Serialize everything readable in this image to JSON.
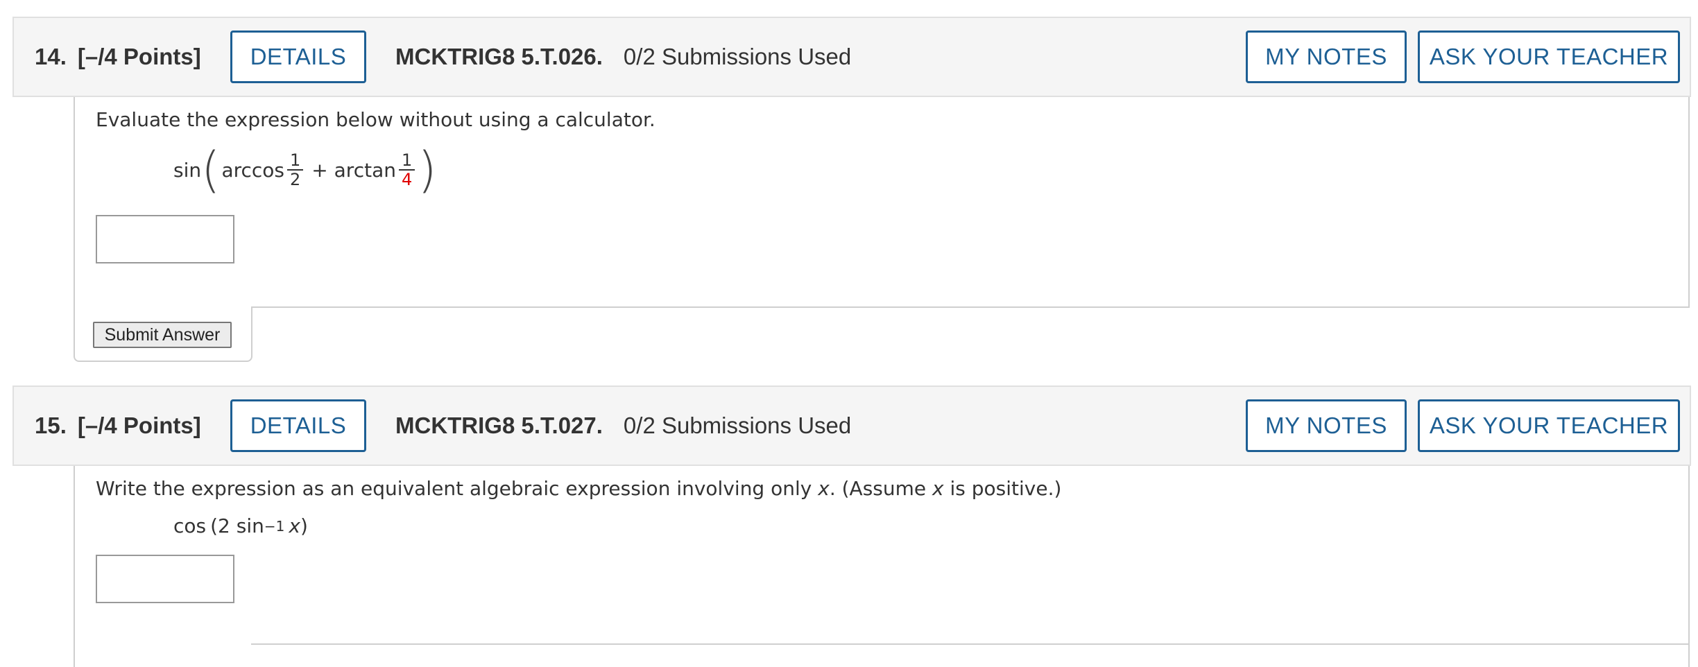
{
  "questions": [
    {
      "number": "14.",
      "points": "[–/4 Points]",
      "details_label": "DETAILS",
      "code": "MCKTRIG8 5.T.026.",
      "submissions": "0/2 Submissions Used",
      "my_notes_label": "MY NOTES",
      "ask_teacher_label": "ASK YOUR TEACHER",
      "prompt": "Evaluate the expression below without using a calculator.",
      "expr": {
        "sin": "sin",
        "arccos": "arccos",
        "frac1_num": "1",
        "frac1_den": "2",
        "plus": "+ arctan",
        "frac2_num": "1",
        "frac2_den": "4"
      },
      "answer_value": "",
      "submit_label": "Submit Answer"
    },
    {
      "number": "15.",
      "points": "[–/4 Points]",
      "details_label": "DETAILS",
      "code": "MCKTRIG8 5.T.027.",
      "submissions": "0/2 Submissions Used",
      "my_notes_label": "MY NOTES",
      "ask_teacher_label": "ASK YOUR TEACHER",
      "prompt_pre": "Write the expression as an equivalent algebraic expression involving only ",
      "prompt_var": "x",
      "prompt_mid": ". (Assume ",
      "prompt_var2": "x",
      "prompt_post": " is positive.)",
      "expr": {
        "cos": "cos",
        "open": "(2 sin",
        "sup": "−1",
        "var": "x",
        "close": ")"
      },
      "answer_value": ""
    }
  ],
  "colors": {
    "accent": "#1d5f94",
    "highlight_red": "#e00000",
    "header_bg": "#f5f5f5"
  }
}
